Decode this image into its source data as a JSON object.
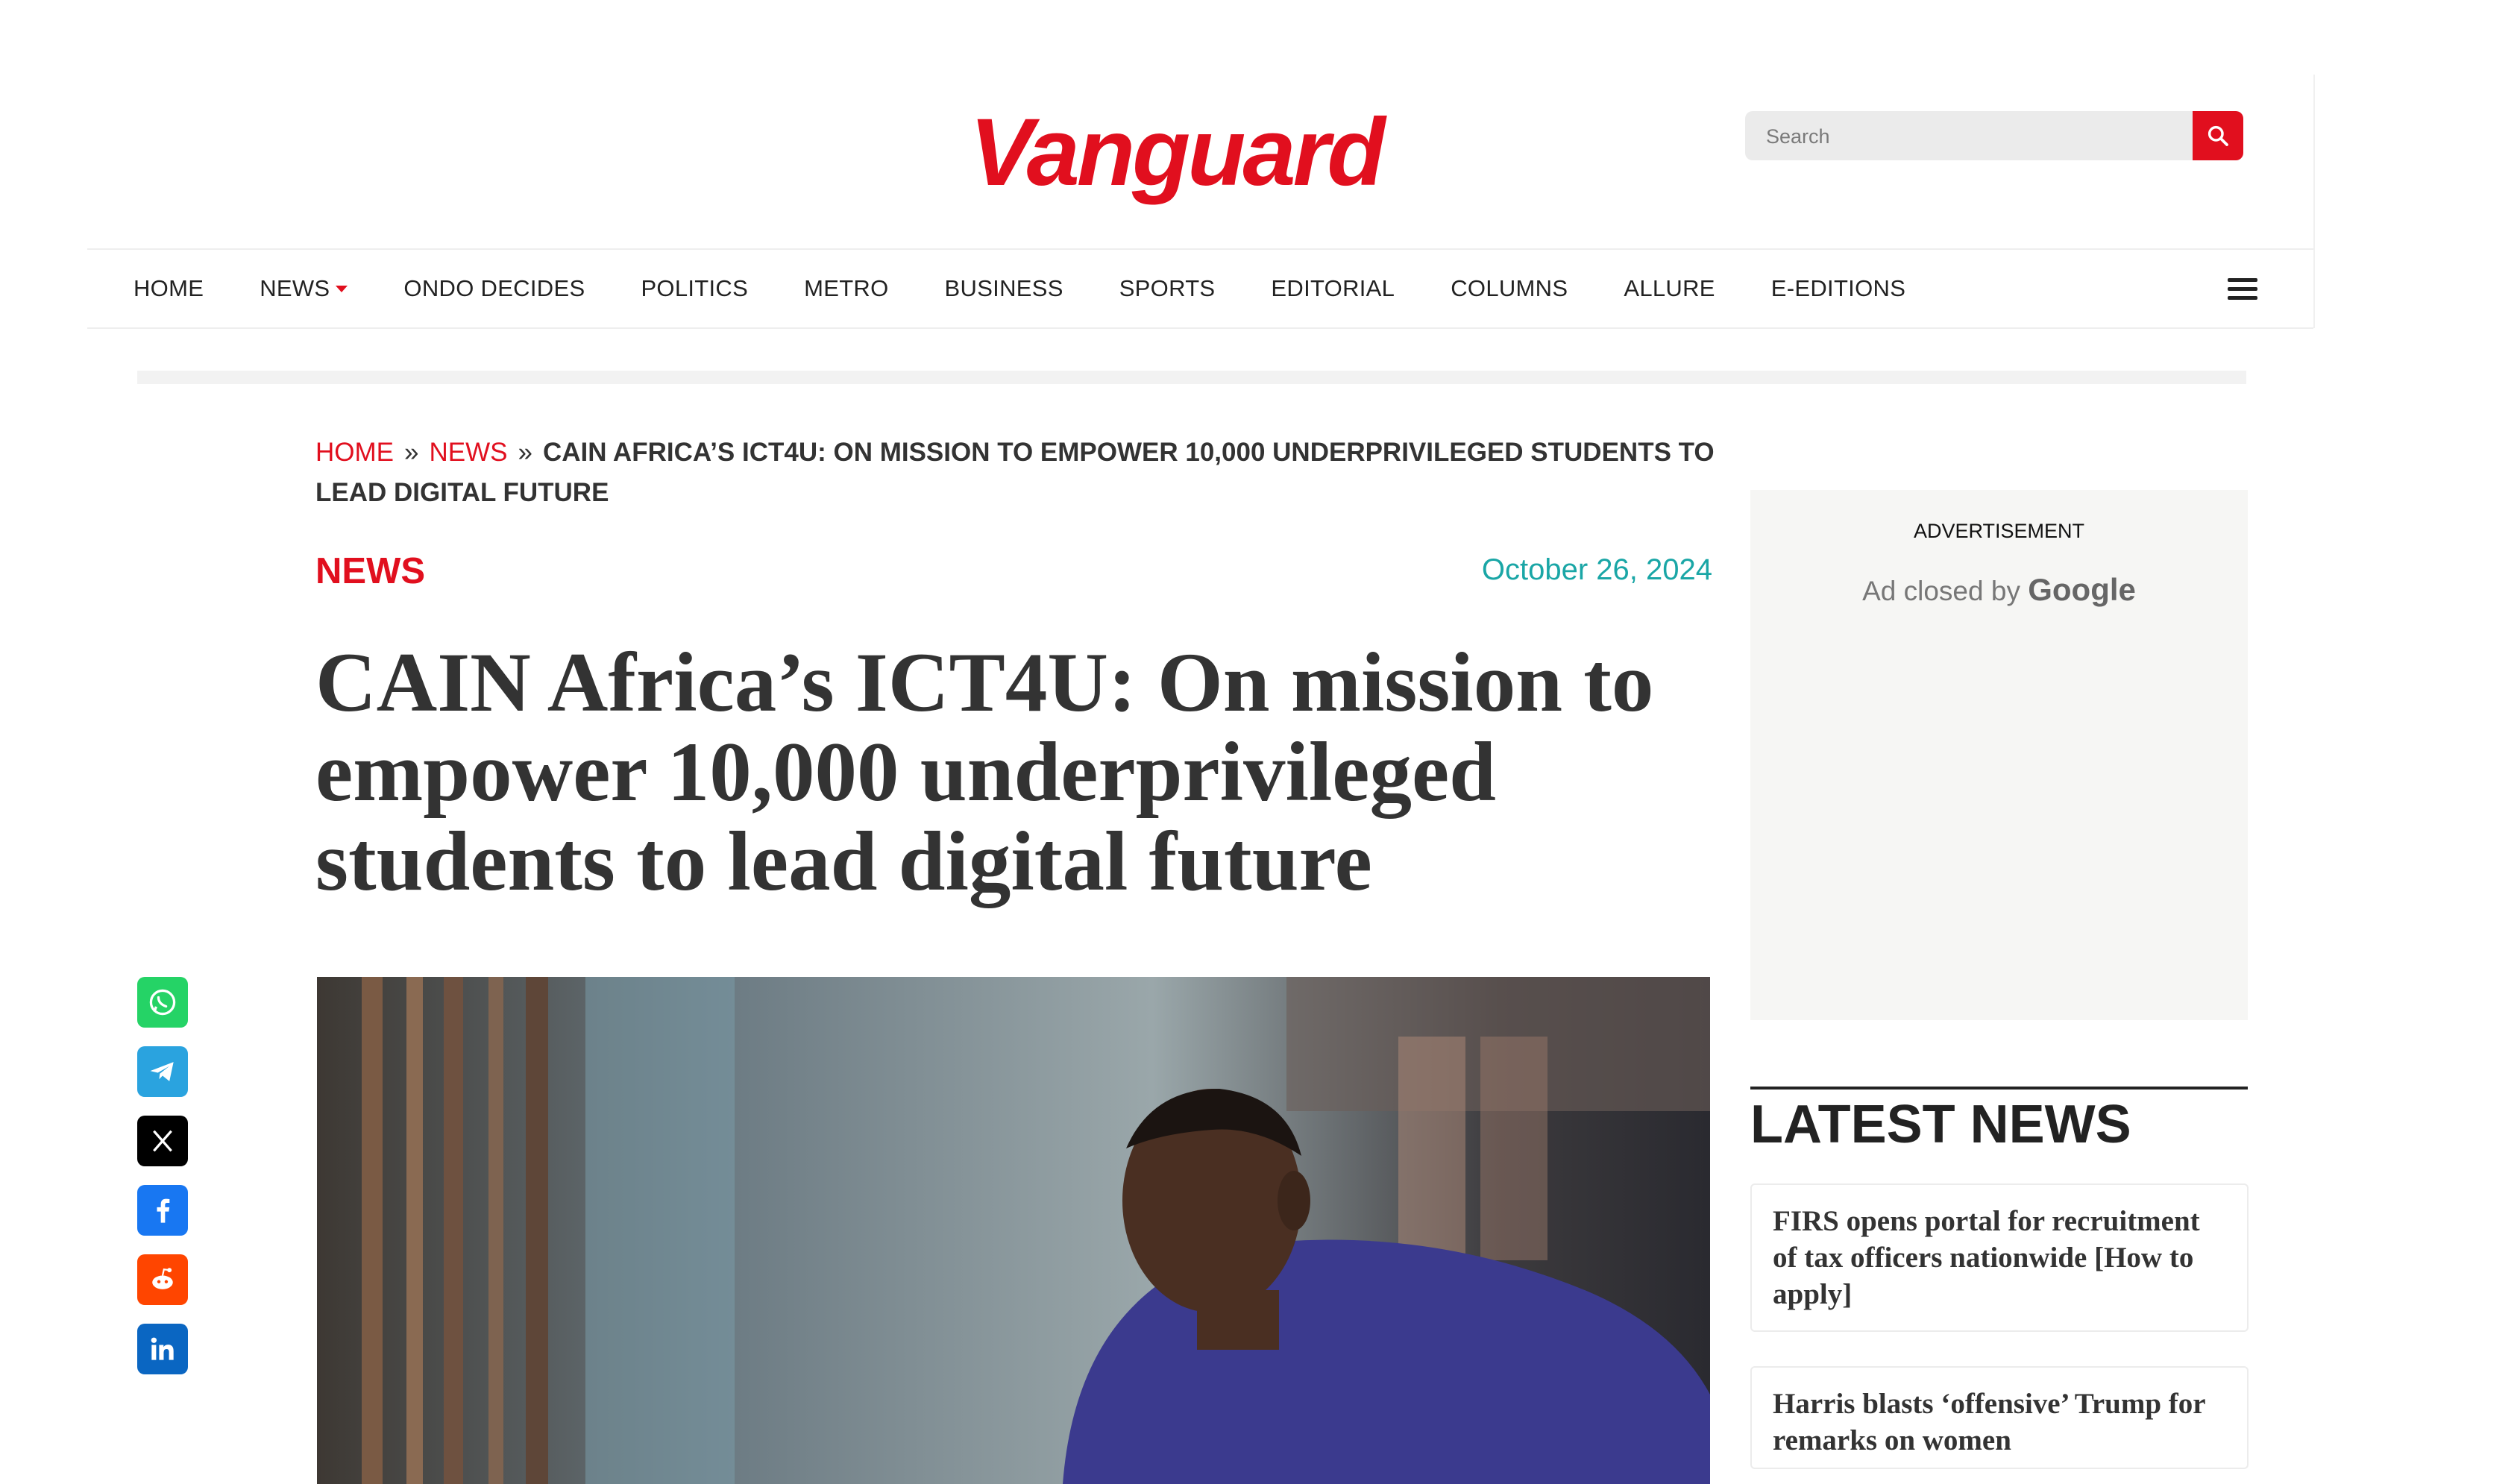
{
  "header": {
    "logo": "Vanguard",
    "search_placeholder": "Search"
  },
  "nav": {
    "items": [
      "HOME",
      "NEWS",
      "ONDO DECIDES",
      "POLITICS",
      "METRO",
      "BUSINESS",
      "SPORTS",
      "EDITORIAL",
      "COLUMNS",
      "ALLURE",
      "E-EDITIONS"
    ]
  },
  "breadcrumb": {
    "home": "HOME",
    "news": "NEWS",
    "sep1": "»",
    "sep2": "»",
    "current": "CAIN AFRICA’S ICT4U: ON MISSION TO EMPOWER 10,000 UNDERPRIVILEGED STUDENTS TO LEAD DIGITAL FUTURE"
  },
  "article": {
    "category": "NEWS",
    "date": "October 26, 2024",
    "title": "CAIN Africa’s ICT4U: On mission to empower 10,000 underprivileged students to lead digital future"
  },
  "ad": {
    "label": "ADVERTISEMENT",
    "closed_text": "Ad closed by",
    "brand": "Google"
  },
  "latest": {
    "heading": "LATEST NEWS",
    "items": [
      "FIRS opens portal for recruitment of tax officers nationwide [How to apply]",
      "Harris blasts ‘offensive’ Trump for remarks on women"
    ]
  },
  "social": [
    "whatsapp-icon",
    "telegram-icon",
    "x-icon",
    "facebook-icon",
    "reddit-icon",
    "linkedin-icon"
  ],
  "colors": {
    "brand_red": "#e10f1e",
    "date_teal": "#1aa6a6"
  }
}
